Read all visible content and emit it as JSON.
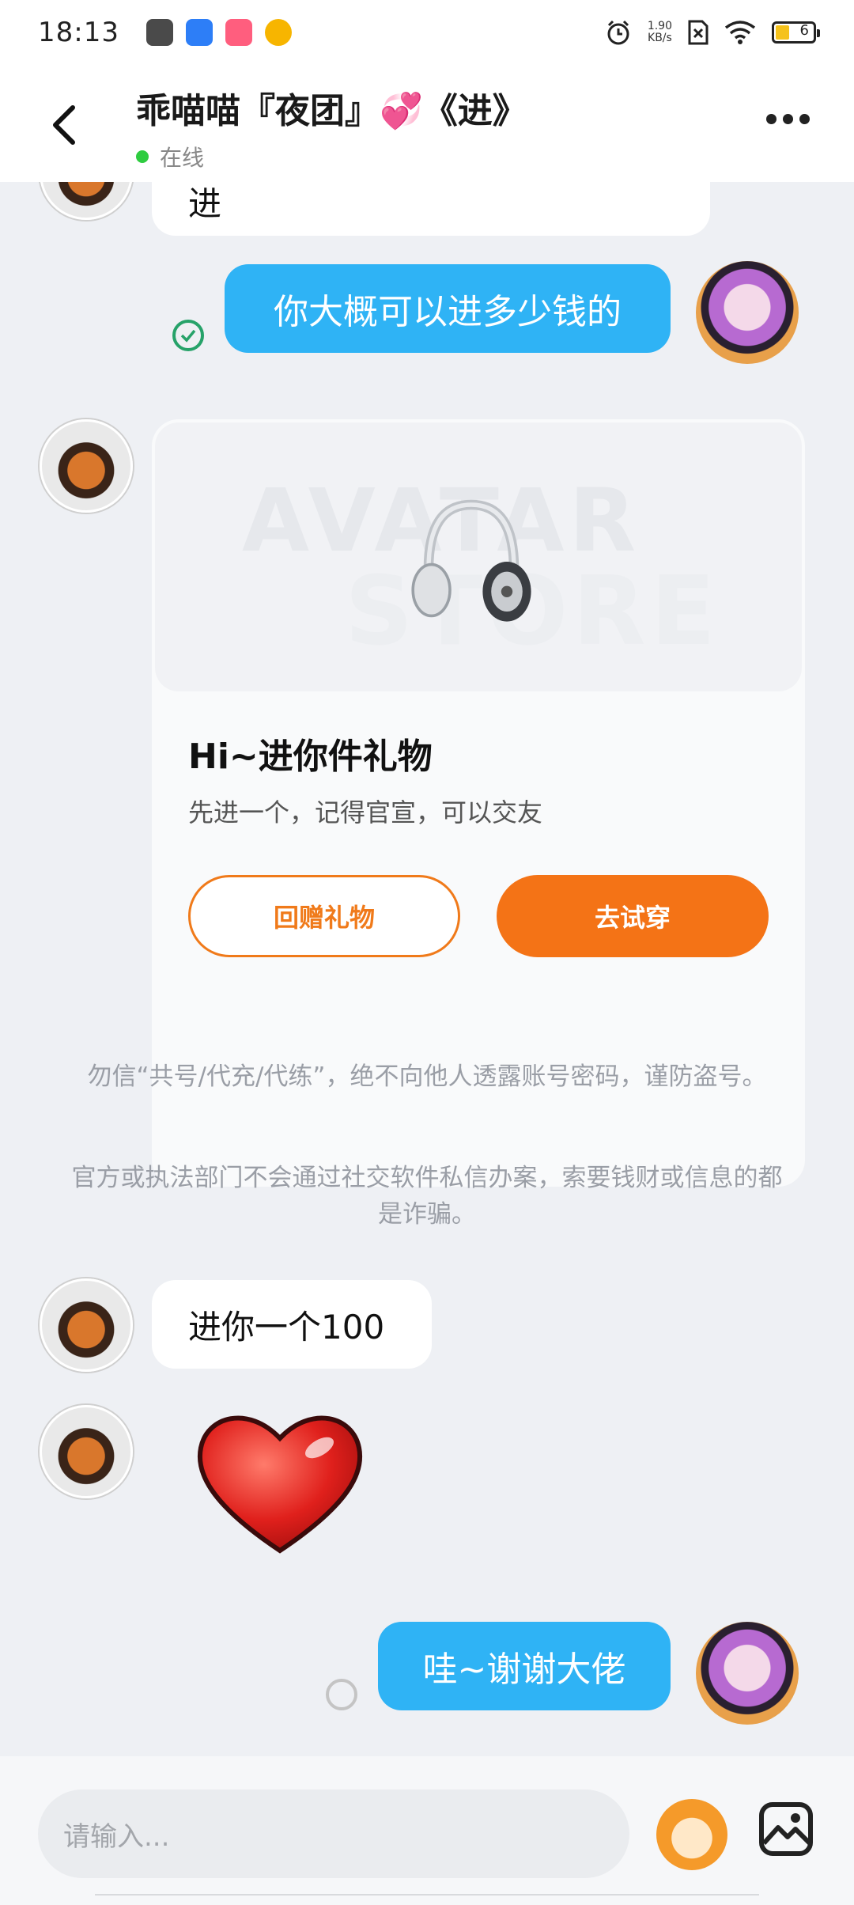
{
  "status_bar": {
    "time": "18:13",
    "net_speed_value": "1.90",
    "net_speed_unit": "KB/s",
    "battery_level": "6"
  },
  "header": {
    "title": "乖喵喵『夜团』💞《进》",
    "status": "在线"
  },
  "messages": {
    "prev_in_text": "进",
    "out_1": "你大概可以进多少钱的",
    "gift": {
      "watermark_1": "AVATAR",
      "watermark_2": "STORE",
      "title": "Hi~进你件礼物",
      "desc": "先进一个，记得官宣，可以交友",
      "btn_return": "回赠礼物",
      "btn_try": "去试穿"
    },
    "notice_1": "勿信“共号/代充/代练”，绝不向他人透露账号密码，谨防盗号。",
    "notice_2": "官方或执法部门不会通过社交软件私信办案，索要钱财或信息的都是诈骗。",
    "in_2": "进你一个100",
    "out_2": "哇~谢谢大佬"
  },
  "input": {
    "placeholder": "请输入..."
  },
  "colors": {
    "accent_blue": "#2fb3f5",
    "accent_orange": "#f47316",
    "online_green": "#2ecc40"
  }
}
